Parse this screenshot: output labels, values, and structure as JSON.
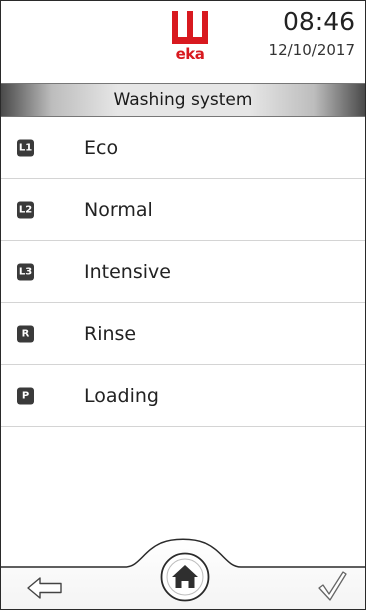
{
  "header": {
    "brand": "eka",
    "time": "08:46",
    "date": "12/10/2017",
    "brand_color": "#d8191f"
  },
  "title": "Washing system",
  "programs": [
    {
      "badge": "L1",
      "label": "Eco"
    },
    {
      "badge": "L2",
      "label": "Normal"
    },
    {
      "badge": "L3",
      "label": "Intensive"
    },
    {
      "badge": "R",
      "label": "Rinse"
    },
    {
      "badge": "P",
      "label": "Loading"
    }
  ],
  "footer": {
    "back_icon": "arrow-left-outline-icon",
    "home_icon": "home-icon",
    "confirm_icon": "checkmark-icon"
  }
}
